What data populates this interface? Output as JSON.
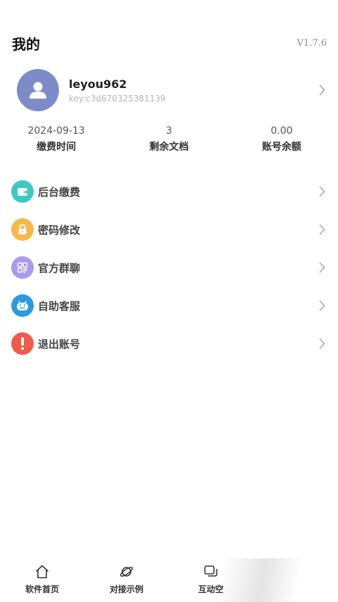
{
  "header": {
    "title": "我的",
    "version": "V1.7.6"
  },
  "profile": {
    "username": "leyou962",
    "key": "key:c3d670325381139"
  },
  "stats": [
    {
      "value": "2024-09-13",
      "label": "缴费时间"
    },
    {
      "value": "3",
      "label": "剩余文档"
    },
    {
      "value": "0.00",
      "label": "账号余额"
    }
  ],
  "menu": [
    {
      "label": "后台缴费",
      "icon": "wallet-icon",
      "color": "#3ec8c0"
    },
    {
      "label": "密码修改",
      "icon": "lock-icon",
      "color": "#f7b84a"
    },
    {
      "label": "官方群聊",
      "icon": "qrcode-icon",
      "color": "#a79af0"
    },
    {
      "label": "自助客服",
      "icon": "robot-icon",
      "color": "#2a9be0"
    },
    {
      "label": "退出账号",
      "icon": "exclamation-icon",
      "color": "#f05a4a"
    }
  ],
  "tabbar": [
    {
      "label": "软件首页",
      "icon": "home-icon"
    },
    {
      "label": "对接示例",
      "icon": "planet-icon"
    },
    {
      "label": "互动空",
      "icon": "chat-icon"
    }
  ]
}
